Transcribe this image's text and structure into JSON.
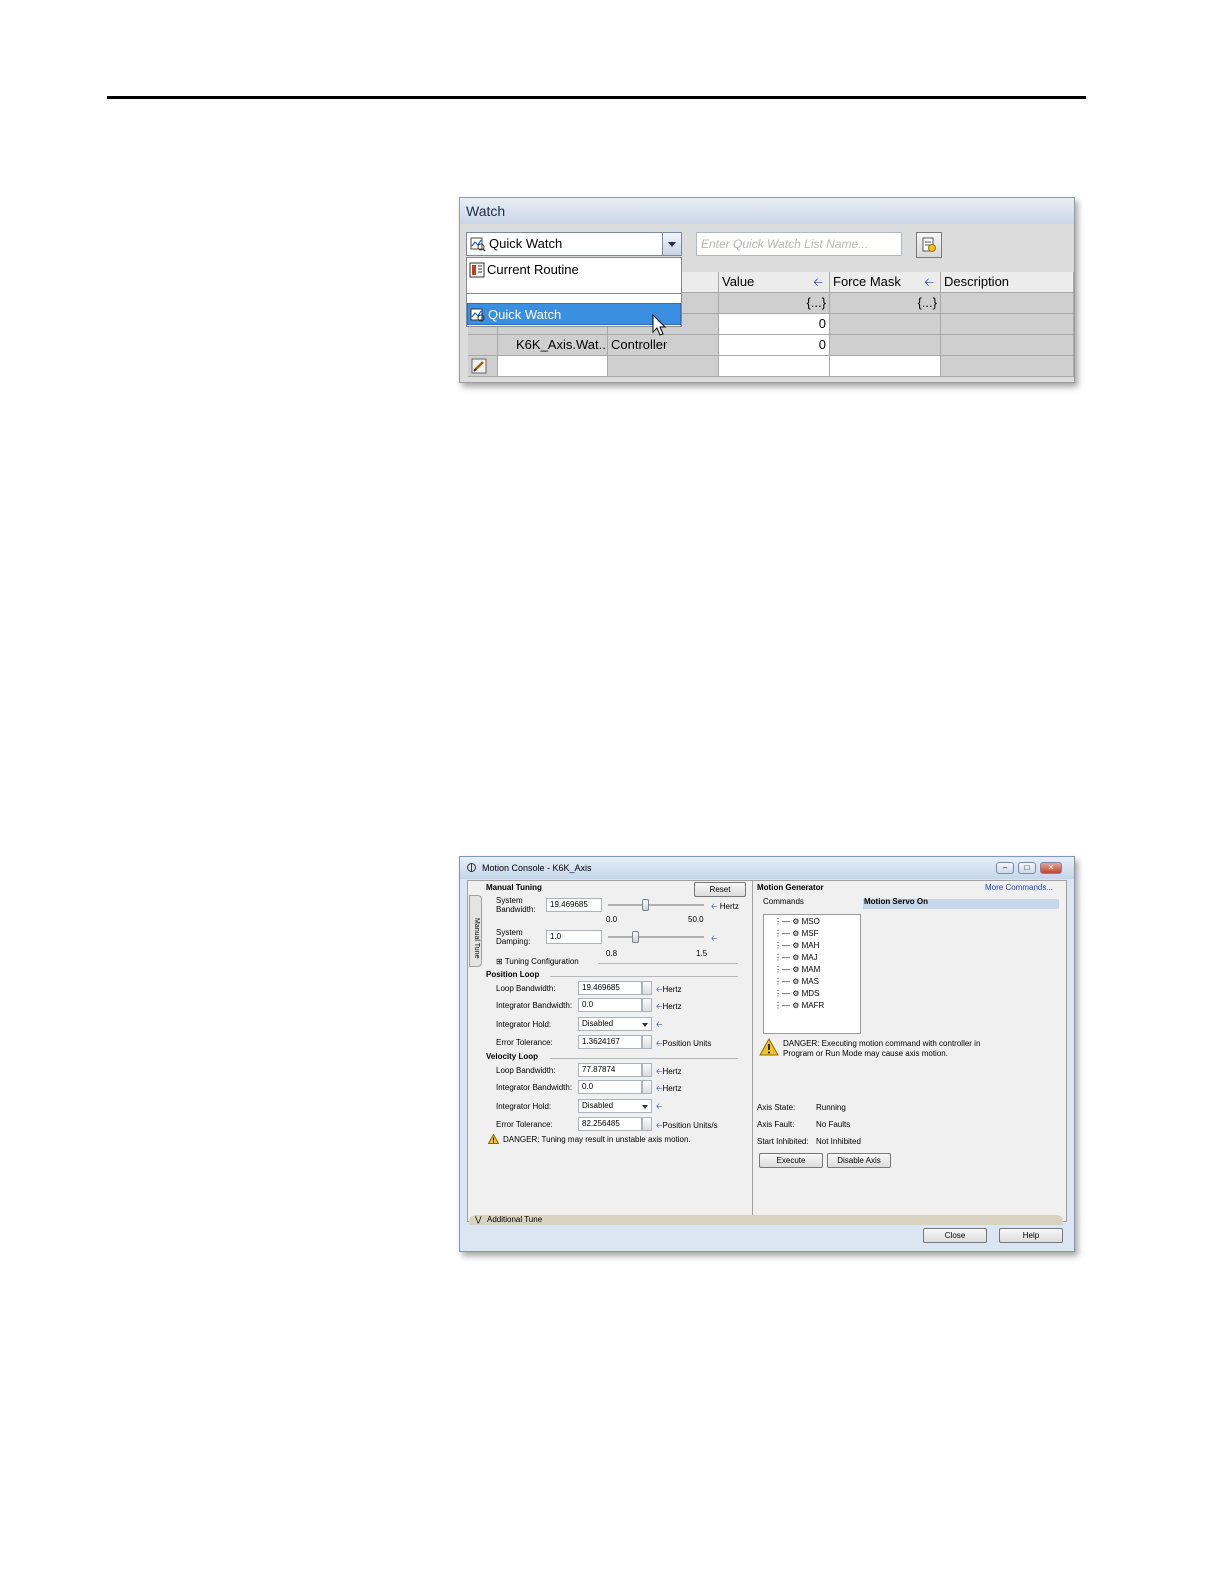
{
  "watch": {
    "title": "Watch",
    "quick_watch_selected": "Quick Watch",
    "name_placeholder": "Enter Quick Watch List Name...",
    "columns": {
      "value": "Value",
      "force_mask": "Force Mask",
      "description": "Description"
    },
    "rows": [
      {
        "name": "",
        "scope": "",
        "value": "{...}",
        "force_mask": "{...}"
      },
      {
        "name": "",
        "scope": "",
        "value": "0",
        "force_mask": ""
      },
      {
        "name": "K6K_Axis.Wat...",
        "scope": "Controller",
        "value": "0",
        "force_mask": ""
      }
    ],
    "dropdown_items": [
      "Current Routine",
      "Quick Watch"
    ]
  },
  "motion_console": {
    "title": "Motion Console - K6K_Axis",
    "side_tab": "Manual Tune",
    "manual_tuning": {
      "heading": "Manual Tuning",
      "reset": "Reset",
      "system_bandwidth_label": "System\nBandwidth:",
      "system_bandwidth_value": "19.469685",
      "bandwidth_unit": "Hertz",
      "bandwidth_min": "0.0",
      "bandwidth_max": "50.0",
      "system_damping_label": "System\nDamping:",
      "system_damping_value": "1.0",
      "damping_min": "0.8",
      "damping_max": "1.5",
      "tuning_config": "Tuning Configuration"
    },
    "position_loop": {
      "heading": "Position Loop",
      "loop_bandwidth_label": "Loop Bandwidth:",
      "loop_bandwidth_value": "19.469685",
      "loop_bandwidth_unit": "Hertz",
      "integrator_bandwidth_label": "Integrator Bandwidth:",
      "integrator_bandwidth_value": "0.0",
      "integrator_bandwidth_unit": "Hertz",
      "integrator_hold_label": "Integrator Hold:",
      "integrator_hold_value": "Disabled",
      "error_tolerance_label": "Error Tolerance:",
      "error_tolerance_value": "1.3624167",
      "error_tolerance_unit": "Position Units"
    },
    "velocity_loop": {
      "heading": "Velocity Loop",
      "loop_bandwidth_label": "Loop Bandwidth:",
      "loop_bandwidth_value": "77.87874",
      "loop_bandwidth_unit": "Hertz",
      "integrator_bandwidth_label": "Integrator Bandwidth:",
      "integrator_bandwidth_value": "0.0",
      "integrator_bandwidth_unit": "Hertz",
      "integrator_hold_label": "Integrator Hold:",
      "integrator_hold_value": "Disabled",
      "error_tolerance_label": "Error Tolerance:",
      "error_tolerance_value": "82.256485",
      "error_tolerance_unit": "Position Units/s"
    },
    "tuning_danger": "DANGER: Tuning may result in unstable axis motion.",
    "motion_generator": {
      "heading": "Motion Generator",
      "more_commands": "More Commands...",
      "commands_label": "Commands",
      "selected_command": "Motion Servo On",
      "commands": [
        "MSO",
        "MSF",
        "MAH",
        "MAJ",
        "MAM",
        "MAS",
        "MDS",
        "MAFR"
      ],
      "danger_line1": "DANGER: Executing motion command with controller in",
      "danger_line2": "Program or Run Mode may cause axis motion.",
      "axis_state_label": "Axis State:",
      "axis_state_value": "Running",
      "axis_fault_label": "Axis Fault:",
      "axis_fault_value": "No Faults",
      "start_inhibited_label": "Start Inhibited:",
      "start_inhibited_value": "Not Inhibited",
      "execute": "Execute",
      "disable_axis": "Disable Axis"
    },
    "additional_tune": "Additional Tune",
    "close": "Close",
    "help": "Help"
  }
}
